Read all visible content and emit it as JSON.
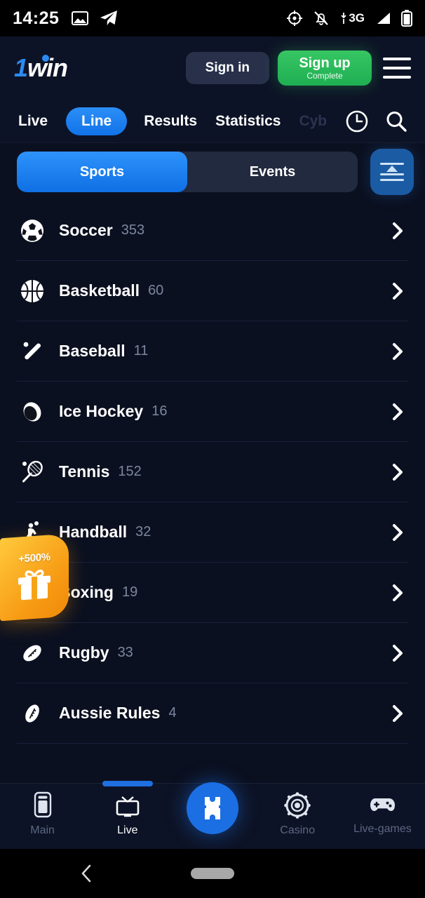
{
  "status_bar": {
    "time": "14:25",
    "left_icons": [
      "image-icon",
      "telegram-icon"
    ],
    "right_icons": [
      "location-target-icon",
      "notifications-muted-icon",
      "battery-icon"
    ],
    "network_label": "3G"
  },
  "header": {
    "logo_one": "1",
    "logo_win": "win",
    "sign_in_label": "Sign in",
    "sign_up_label": "Sign up",
    "sign_up_sub_label": "Complete",
    "menu_icon": "hamburger-menu-icon",
    "accent_green": "#2dbe5f"
  },
  "nav_tabs": {
    "items": [
      {
        "label": "Live",
        "active": false
      },
      {
        "label": "Line",
        "active": true
      },
      {
        "label": "Results",
        "active": false
      },
      {
        "label": "Statistics",
        "active": false
      },
      {
        "label": "Cyb",
        "active": false,
        "faded": true
      }
    ],
    "clock_icon": "clock-icon",
    "search_icon": "search-icon",
    "active_color": "#1d82f0"
  },
  "segmented": {
    "sports_label": "Sports",
    "events_label": "Events",
    "active": "Sports",
    "sort_icon": "sort-ascending-icon"
  },
  "sports": [
    {
      "name": "Soccer",
      "count": "353",
      "icon": "soccer-ball-icon"
    },
    {
      "name": "Basketball",
      "count": "60",
      "icon": "basketball-icon"
    },
    {
      "name": "Baseball",
      "count": "11",
      "icon": "baseball-bat-icon"
    },
    {
      "name": "Ice Hockey",
      "count": "16",
      "icon": "hockey-puck-icon"
    },
    {
      "name": "Tennis",
      "count": "152",
      "icon": "tennis-racket-icon"
    },
    {
      "name": "Handball",
      "count": "32",
      "icon": "handball-player-icon"
    },
    {
      "name": "Boxing",
      "count": "19",
      "icon": "boxing-glove-icon"
    },
    {
      "name": "Rugby",
      "count": "33",
      "icon": "rugby-ball-icon"
    },
    {
      "name": "Aussie Rules",
      "count": "4",
      "icon": "aussie-rules-ball-icon"
    }
  ],
  "promo": {
    "badge_text": "+500%",
    "icon": "gift-box-icon",
    "color": "#f7a317"
  },
  "bottom_nav": {
    "items": [
      {
        "label": "Main",
        "icon": "phone-app-icon",
        "active": false
      },
      {
        "label": "Live",
        "icon": "tv-icon",
        "active": true
      },
      {
        "label": "Casino",
        "icon": "casino-chip-icon",
        "active": false
      },
      {
        "label": "Live-games",
        "icon": "gamepad-icon",
        "active": false
      }
    ],
    "center_button_icon": "bet-slip-icon",
    "center_button_color": "#1b6fe3"
  },
  "android_nav": {
    "back_icon": "back-chevron-icon",
    "home_pill": "home-indicator-pill"
  }
}
